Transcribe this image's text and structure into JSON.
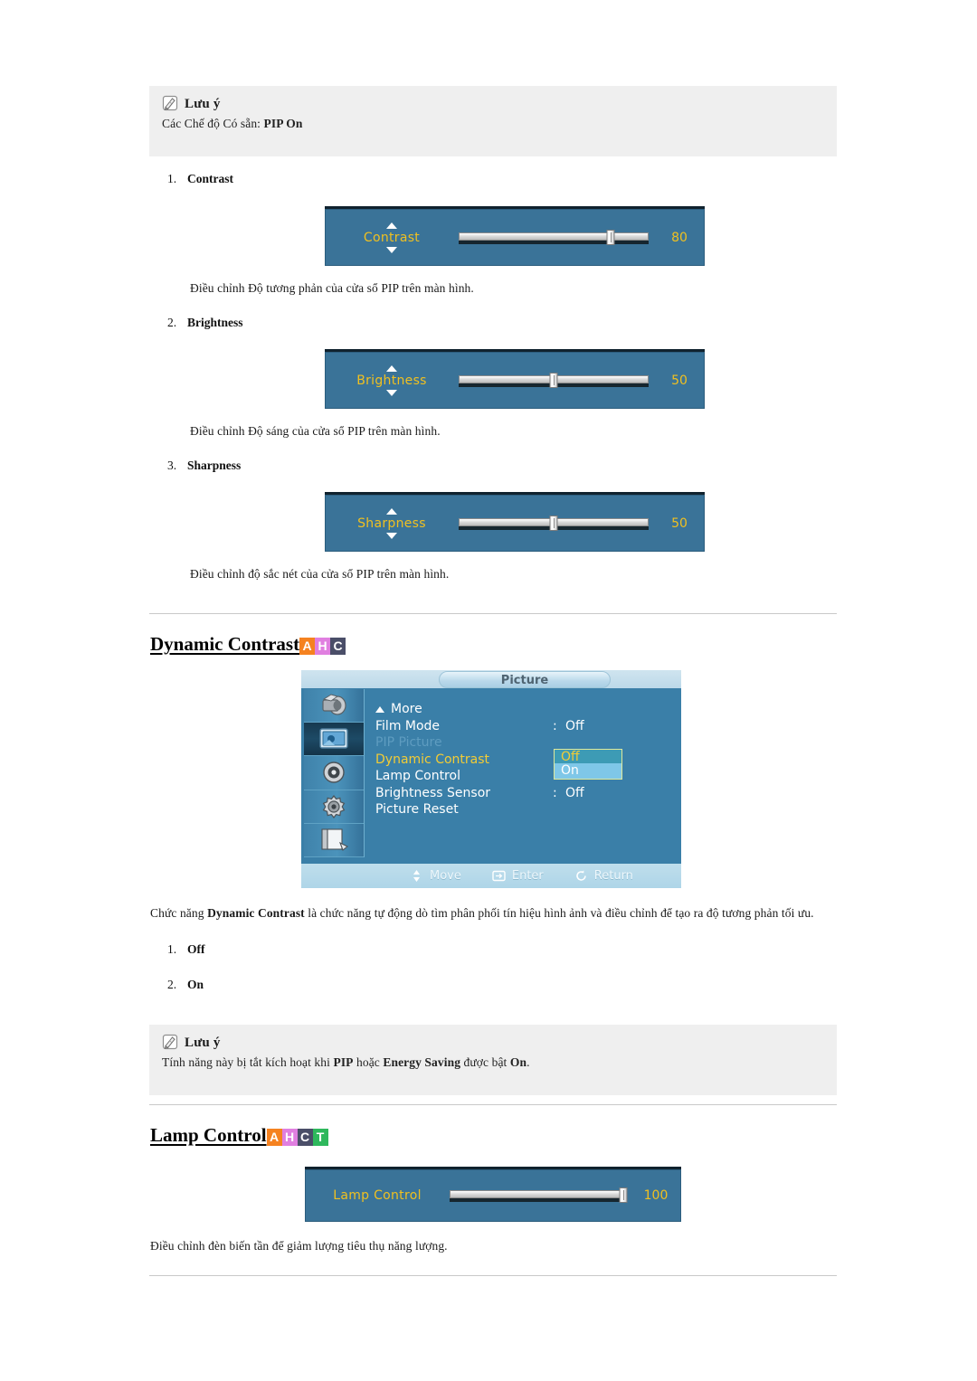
{
  "note_top": {
    "icon": "note-pencil-icon",
    "title": "Lưu ý",
    "body_prefix": "Các Chế độ Có sẵn: ",
    "body_strong": "PIP On"
  },
  "items": [
    {
      "num": "1.",
      "label": "Contrast"
    },
    {
      "num": "2.",
      "label": "Brightness"
    },
    {
      "num": "3.",
      "label": "Sharpness"
    }
  ],
  "sliders": [
    {
      "name": "contrast-slider",
      "label": "Contrast",
      "value": "80",
      "percent": 80,
      "has_arrows": true,
      "arrow_up": "caret-up-icon",
      "arrow_down": "caret-down-icon"
    },
    {
      "name": "brightness-slider",
      "label": "Brightness",
      "value": "50",
      "percent": 50,
      "has_arrows": true,
      "arrow_up": "caret-up-icon",
      "arrow_down": "caret-down-icon"
    },
    {
      "name": "sharpness-slider",
      "label": "Sharpness",
      "value": "50",
      "percent": 50,
      "has_arrows": true,
      "arrow_up": "caret-up-icon",
      "arrow_down": "caret-down-icon"
    },
    {
      "name": "lamp-control-slider",
      "label": "Lamp Control",
      "value": "100",
      "percent": 100,
      "has_arrows": false
    }
  ],
  "descriptions": {
    "contrast": "Điều chỉnh Độ tương phản của cửa sổ PIP trên màn hình.",
    "brightness": "Điều chỉnh Độ sáng của cửa sổ PIP trên màn hình.",
    "sharpness": "Điều chỉnh độ sắc nét của cửa sổ PIP trên màn hình.",
    "lamp_control": "Điều chỉnh đèn biến tần để giảm lượng tiêu thụ năng lượng."
  },
  "headings": {
    "dynamic_contrast": {
      "text": "Dynamic Contrast",
      "badges": [
        "A",
        "H",
        "C"
      ]
    },
    "lamp_control": {
      "text": "Lamp Control",
      "badges": [
        "A",
        "H",
        "C",
        "T"
      ]
    }
  },
  "osd_menu": {
    "title": "Picture",
    "sidebar": [
      {
        "name": "input-icon",
        "selected": false
      },
      {
        "name": "picture-icon",
        "selected": true
      },
      {
        "name": "sound-speaker-icon",
        "selected": false
      },
      {
        "name": "setup-gear-icon",
        "selected": false
      },
      {
        "name": "multi-control-icon",
        "selected": false
      }
    ],
    "rows": [
      {
        "label": "More",
        "colon": "",
        "value": "",
        "state": "more"
      },
      {
        "label": "Film Mode",
        "colon": ":",
        "value": "Off",
        "state": "normal"
      },
      {
        "label": "PIP Picture",
        "colon": "",
        "value": "",
        "state": "dim"
      },
      {
        "label": "Dynamic Contrast",
        "colon": ":",
        "value": "",
        "state": "active"
      },
      {
        "label": "Lamp Control",
        "colon": ":",
        "value": "",
        "state": "normal"
      },
      {
        "label": "Brightness Sensor",
        "colon": ":",
        "value": "Off",
        "state": "normal"
      },
      {
        "label": "Picture Reset",
        "colon": "",
        "value": "",
        "state": "normal"
      }
    ],
    "dropdown": {
      "selected": "Off",
      "options": [
        "Off",
        "On"
      ]
    },
    "footer": [
      {
        "icon": "updown-arrow-icon",
        "label": "Move"
      },
      {
        "icon": "enter-icon",
        "label": "Enter"
      },
      {
        "icon": "return-icon",
        "label": "Return"
      }
    ]
  },
  "dynamic_contrast_paragraph": {
    "prefix": "Chức năng ",
    "strong1": "Dynamic Contrast",
    "suffix": " là chức năng tự động dò tìm phân phối tín hiệu hình ảnh và điều chỉnh để tạo ra độ tương phản tối ưu."
  },
  "dynamic_contrast_options": [
    {
      "num": "1.",
      "label": "Off"
    },
    {
      "num": "2.",
      "label": "On"
    }
  ],
  "note_bottom": {
    "icon": "note-pencil-icon",
    "title": "Lưu ý",
    "body_prefix": "Tính năng này bị tắt kích hoạt khi ",
    "body_strong1": "PIP",
    "body_mid": " hoặc ",
    "body_strong2": "Energy Saving",
    "body_mid2": " được bật ",
    "body_strong3": "On",
    "body_suffix": "."
  },
  "colors": {
    "osd_slider_bg": "#3a7398",
    "osd_label": "#f0c020",
    "osd_menu_bg": "#3a7fa8",
    "badge_a": "#f58220",
    "badge_h": "#e07fe0",
    "badge_c": "#4a4e68",
    "badge_t": "#2eb85c",
    "note_bg": "#efefef"
  }
}
